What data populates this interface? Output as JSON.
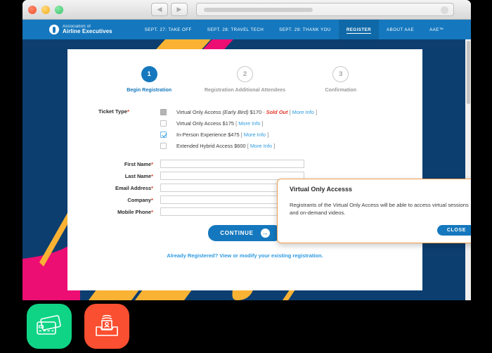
{
  "browser": {
    "back_icon": "◀",
    "forward_icon": "▶",
    "address_placeholder": ""
  },
  "site": {
    "brand": {
      "line1": "Association of",
      "line2": "Airline Executives",
      "mark_icon": "airplane-roundel-icon"
    },
    "nav": [
      {
        "label": "SEPT. 27: TAKE OFF",
        "active": false
      },
      {
        "label": "SEPT. 28: TRAVEL TECH",
        "active": false
      },
      {
        "label": "SEPT. 29: THANK YOU",
        "active": false
      },
      {
        "label": "REGISTER",
        "active": true
      },
      {
        "label": "ABOUT AAE",
        "active": false
      },
      {
        "label": "AAE™",
        "active": false
      }
    ]
  },
  "steps": [
    {
      "number": "1",
      "label": "Begin Registration",
      "state": "done"
    },
    {
      "number": "2",
      "label": "Registration Additional Attendees",
      "state": "todo"
    },
    {
      "number": "3",
      "label": "Confirmation",
      "state": "todo"
    }
  ],
  "ticket": {
    "legend": "Ticket Type",
    "required_mark": "*",
    "options": [
      {
        "name": "Virtual Only Access",
        "badge": "(Early Bird)",
        "price": "$170",
        "status": "Sold Out",
        "more_info": "More Info",
        "state": "disabled"
      },
      {
        "name": "Virtual Only Access",
        "badge": "",
        "price": "$175",
        "status": "",
        "more_info": "More Info",
        "state": "unchecked"
      },
      {
        "name": "In-Person Experience",
        "badge": "",
        "price": "$475",
        "status": "",
        "more_info": "More Info",
        "state": "checked"
      },
      {
        "name": "Extended Hybrid Access",
        "badge": "",
        "price": "$600",
        "status": "",
        "more_info": "More Info",
        "state": "unchecked"
      }
    ]
  },
  "form": {
    "fields": [
      {
        "label": "First Name",
        "required": "*",
        "value": "",
        "placeholder": ""
      },
      {
        "label": "Last Name",
        "required": "*",
        "value": "",
        "placeholder": ""
      },
      {
        "label": "Email Address",
        "required": "*",
        "value": "",
        "placeholder": ""
      },
      {
        "label": "Company",
        "required": "*",
        "value": "",
        "placeholder": ""
      },
      {
        "label": "Mobile Phone",
        "required": "*",
        "value": "",
        "placeholder": ""
      }
    ],
    "continue_label": "CONTINUE",
    "continue_arrow_icon": "→",
    "already_registered": "Already Registered? View or modify your existing registration."
  },
  "modal": {
    "title": "Virtual Only Accesss",
    "body": "Registrants of the Virtual Only Access will be able to access virtual sessions and on-demand videos.",
    "close_label": "CLOSE",
    "close_icon": "✕"
  },
  "dock": [
    {
      "name": "credit-cards-icon",
      "color": "#0fd486"
    },
    {
      "name": "contact-inbox-icon",
      "color": "#fa4f30"
    }
  ],
  "colors": {
    "nav_blue": "#1578be",
    "page_navy": "#0c3e70",
    "accent_yellow": "#f9b233",
    "accent_pink": "#ec0e73",
    "modal_border": "#f0a04b",
    "sold_out_red": "#e5392a"
  }
}
